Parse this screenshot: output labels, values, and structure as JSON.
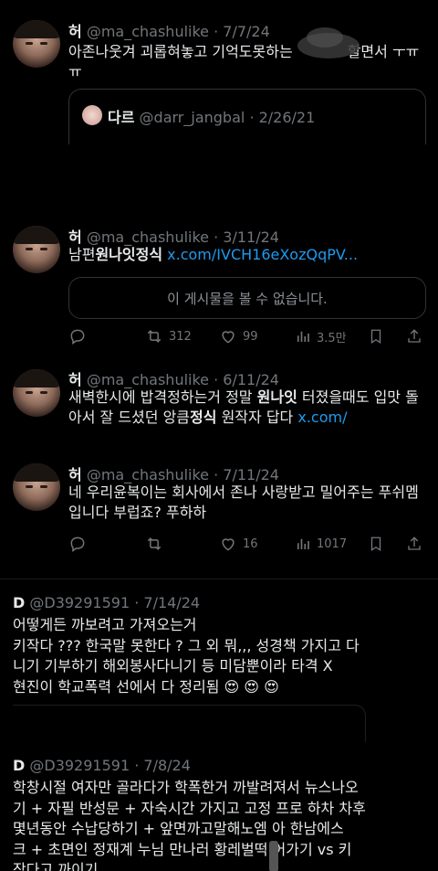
{
  "tweet1": {
    "name": "허",
    "handle": "@ma_chashulike",
    "date": "· 7/7/24",
    "text_a": "아존나웃겨 괴롭혀놓고 기억도못하는",
    "text_b": "할면서 ㅜㅠ",
    "text_c": "ㅠ",
    "quote": {
      "name": "다르",
      "handle": "@darr_jangbal",
      "date": "· 2/26/21"
    }
  },
  "tweet2": {
    "name": "허",
    "handle": "@ma_chashulike",
    "date": "· 3/11/24",
    "text_pre": "남편",
    "text_bold": "원나잇정식",
    "link": "x.com/IVCH16eXozQqPV...",
    "unavailable": "이 게시물을 볼 수 없습니다.",
    "retweets": "312",
    "likes": "99",
    "views": "3.5만"
  },
  "tweet3": {
    "name": "허",
    "handle": "@ma_chashulike",
    "date": "· 6/11/24",
    "line1_pre": "새벽한시에 밥격정하는거 정말 ",
    "line1_bold": "원나잇",
    "line1_post": " 터졌을때도 입맛 돌",
    "line2_pre": "아서 잘 드셨던 앙큼",
    "line2_bold": "정식",
    "line2_post": " 원작자 답다 ",
    "line2_link": "x.com/"
  },
  "tweet4": {
    "name": "허",
    "handle": "@ma_chashulike",
    "date": "· 7/11/24",
    "line1": "네 우리윤복이는 회사에서 존나 사랑받고 밀어주는 푸쉬멤",
    "line2": "입니다 부럽죠? 푸하하",
    "likes": "16",
    "views": "1017"
  },
  "tweet5": {
    "name": "D",
    "handle": "@D39291591",
    "date": "· 7/14/24",
    "line1": "어떻게든 까보려고 가져오는거",
    "line2": "키작다 ??? 한국말 못한다 ? 그 외 뭐,,, 성경책 가지고 다",
    "line3": "니기 기부하기 해외봉사다니기 등 미담뿐이라 타격 X",
    "line4": "현진이 학교폭력 선에서 다 정리됨",
    "emoji": "😍 😍 😍"
  },
  "tweet6": {
    "name": "D",
    "handle": "@D39291591",
    "date": "· 7/8/24",
    "line1": "학창시절 여자만 골라다가 학폭한거 까발려져서 뉴스나오",
    "line2": "기 + 자필 반성문 + 자숙시간 가지고 고정 프로 하차 차후",
    "line3": "몇년동안 수납당하기 + 앞면까고말해노엠 아 한남에스",
    "line4": "크 + 초면인 정재계 누님 만나러 황레벌떡 어가기 vs 키",
    "line5": "작다고 까이기"
  },
  "colors": {
    "background": "#000000",
    "text": "#e7e9ea",
    "muted": "#71767b",
    "link": "#1d9bf0",
    "border": "#2f3336"
  }
}
